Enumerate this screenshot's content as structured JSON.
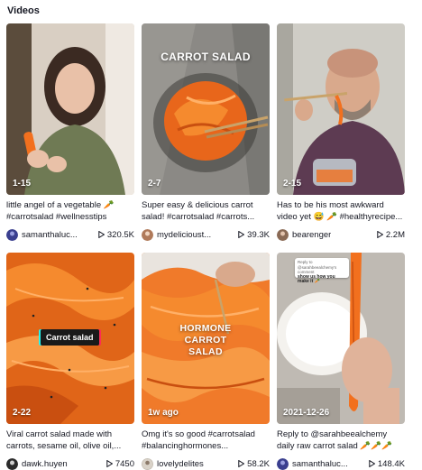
{
  "section": {
    "title": "Videos"
  },
  "videos": [
    {
      "date": "1-15",
      "overlay": "",
      "description": "little angel of a vegetable 🥕 #carrotsalad #wellnesstips",
      "author": "samanthaluc...",
      "views": "320.5K",
      "avatar_color": "#3a3f8f"
    },
    {
      "date": "2-7",
      "overlay": "CARROT SALAD",
      "description": "Super easy & delicious carrot salad! #carrotsalad #carrots...",
      "author": "mydelicioust...",
      "views": "39.3K",
      "avatar_color": "#b07a5a"
    },
    {
      "date": "2-15",
      "overlay": "",
      "description": "Has to be his most awkward video yet 😅 🥕 #healthyrecipe...",
      "author": "bearenger",
      "views": "2.2M",
      "avatar_color": "#8a6a55"
    },
    {
      "date": "2-22",
      "overlay": "Carrot salad",
      "description": "Viral carrot salad made with carrots, sesame oil, olive oil,...",
      "author": "dawk.huyen",
      "views": "7450",
      "avatar_color": "#2b2b2b"
    },
    {
      "date": "1w ago",
      "overlay": "HORMONE CARROT SALAD",
      "overlay_lines": [
        "HORMONE",
        "CARROT",
        "SALAD"
      ],
      "description": "Omg it's so good #carrotsalad #balancinghormones...",
      "author": "lovelydelites",
      "views": "58.2K",
      "avatar_color": "#d9d2c8"
    },
    {
      "date": "2021-12-26",
      "overlay": "",
      "reply_bubble": {
        "top": "Reply to @sarahbeealchemy's comment",
        "main": "show us how you make it 🥕"
      },
      "description": "Reply to @sarahbeealchemy daily raw carrot salad 🥕🥕🥕",
      "author": "samanthaluc...",
      "views": "148.4K",
      "avatar_color": "#3a3f8f"
    }
  ],
  "colors": {
    "accent_carrot": "#f2701e",
    "text": "#161823",
    "tiktok_cyan": "#25f4ee",
    "tiktok_red": "#fe2c55"
  }
}
